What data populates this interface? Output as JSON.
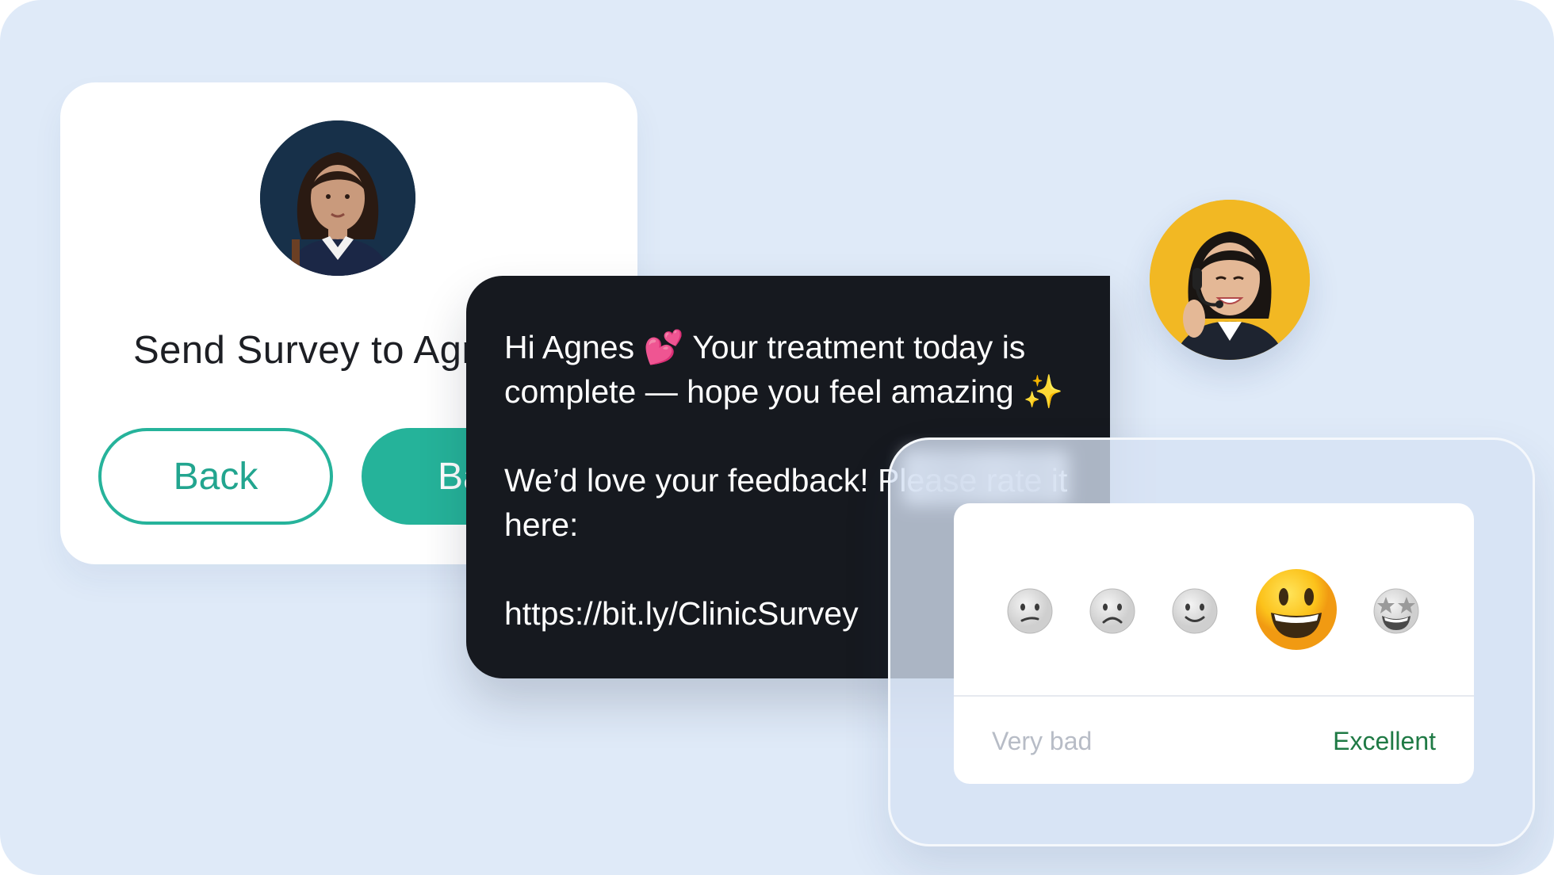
{
  "survey_card": {
    "title": "Send Survey to Agnes",
    "back_label": "Back",
    "primary_label": "Back",
    "avatar": "patient-avatar"
  },
  "sms": {
    "line1": "Hi Agnes 💕 Your treatment today is complete — hope you feel amazing ✨",
    "line2": "We’d love your feedback! Please rate it here:",
    "link": "https://bit.ly/ClinicSurvey"
  },
  "agent": {
    "avatar": "support-agent-avatar"
  },
  "rating": {
    "low_label": "Very bad",
    "high_label": "Excellent",
    "faces": [
      "confused-face-icon",
      "frowning-face-icon",
      "slightly-smiling-face-icon",
      "grinning-face-icon",
      "star-struck-face-icon"
    ],
    "selected_index": 3
  },
  "colors": {
    "background": "#dfeaf8",
    "accent_teal": "#25b39a",
    "sms_bg": "#16191f",
    "excellent_green": "#1f7a45",
    "agent_bg": "#f2b823"
  }
}
